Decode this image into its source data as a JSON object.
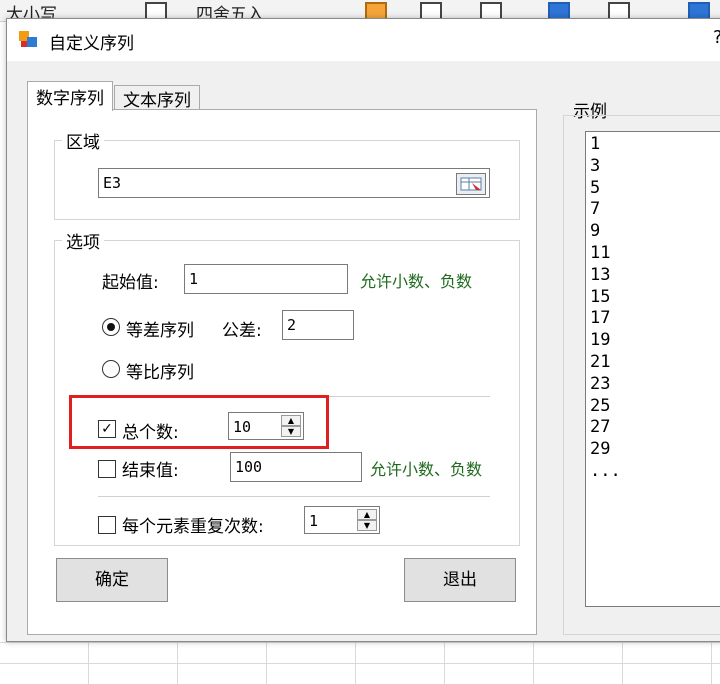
{
  "ribbon": {
    "left_text": "大小写",
    "round_text": "四舍五入"
  },
  "dialog": {
    "title": "自定义序列",
    "help": "?"
  },
  "tabs": [
    {
      "label": "数字序列",
      "active": true
    },
    {
      "label": "文本序列",
      "active": false
    }
  ],
  "range_group": {
    "label": "区域",
    "value": "E3"
  },
  "options_group": {
    "label": "选项",
    "start_label": "起始值:",
    "start_value": "1",
    "start_hint": "允许小数、负数",
    "arith_label": "等差序列",
    "arith_selected": true,
    "diff_label": "公差:",
    "diff_value": "2",
    "geo_label": "等比序列",
    "total_label": "总个数:",
    "total_checked": true,
    "total_value": "10",
    "end_label": "结束值:",
    "end_checked": false,
    "end_value": "100",
    "end_hint": "允许小数、负数",
    "repeat_label": "每个元素重复次数:",
    "repeat_checked": false,
    "repeat_value": "1"
  },
  "buttons": {
    "ok": "确定",
    "exit": "退出"
  },
  "preview": {
    "label": "示例",
    "values": [
      "1",
      "3",
      "5",
      "7",
      "9",
      "11",
      "13",
      "15",
      "17",
      "19",
      "21",
      "23",
      "25",
      "27",
      "29",
      "..."
    ]
  },
  "colors": {
    "hint_green": "#1e6b1e",
    "highlight_red": "#e02020"
  }
}
